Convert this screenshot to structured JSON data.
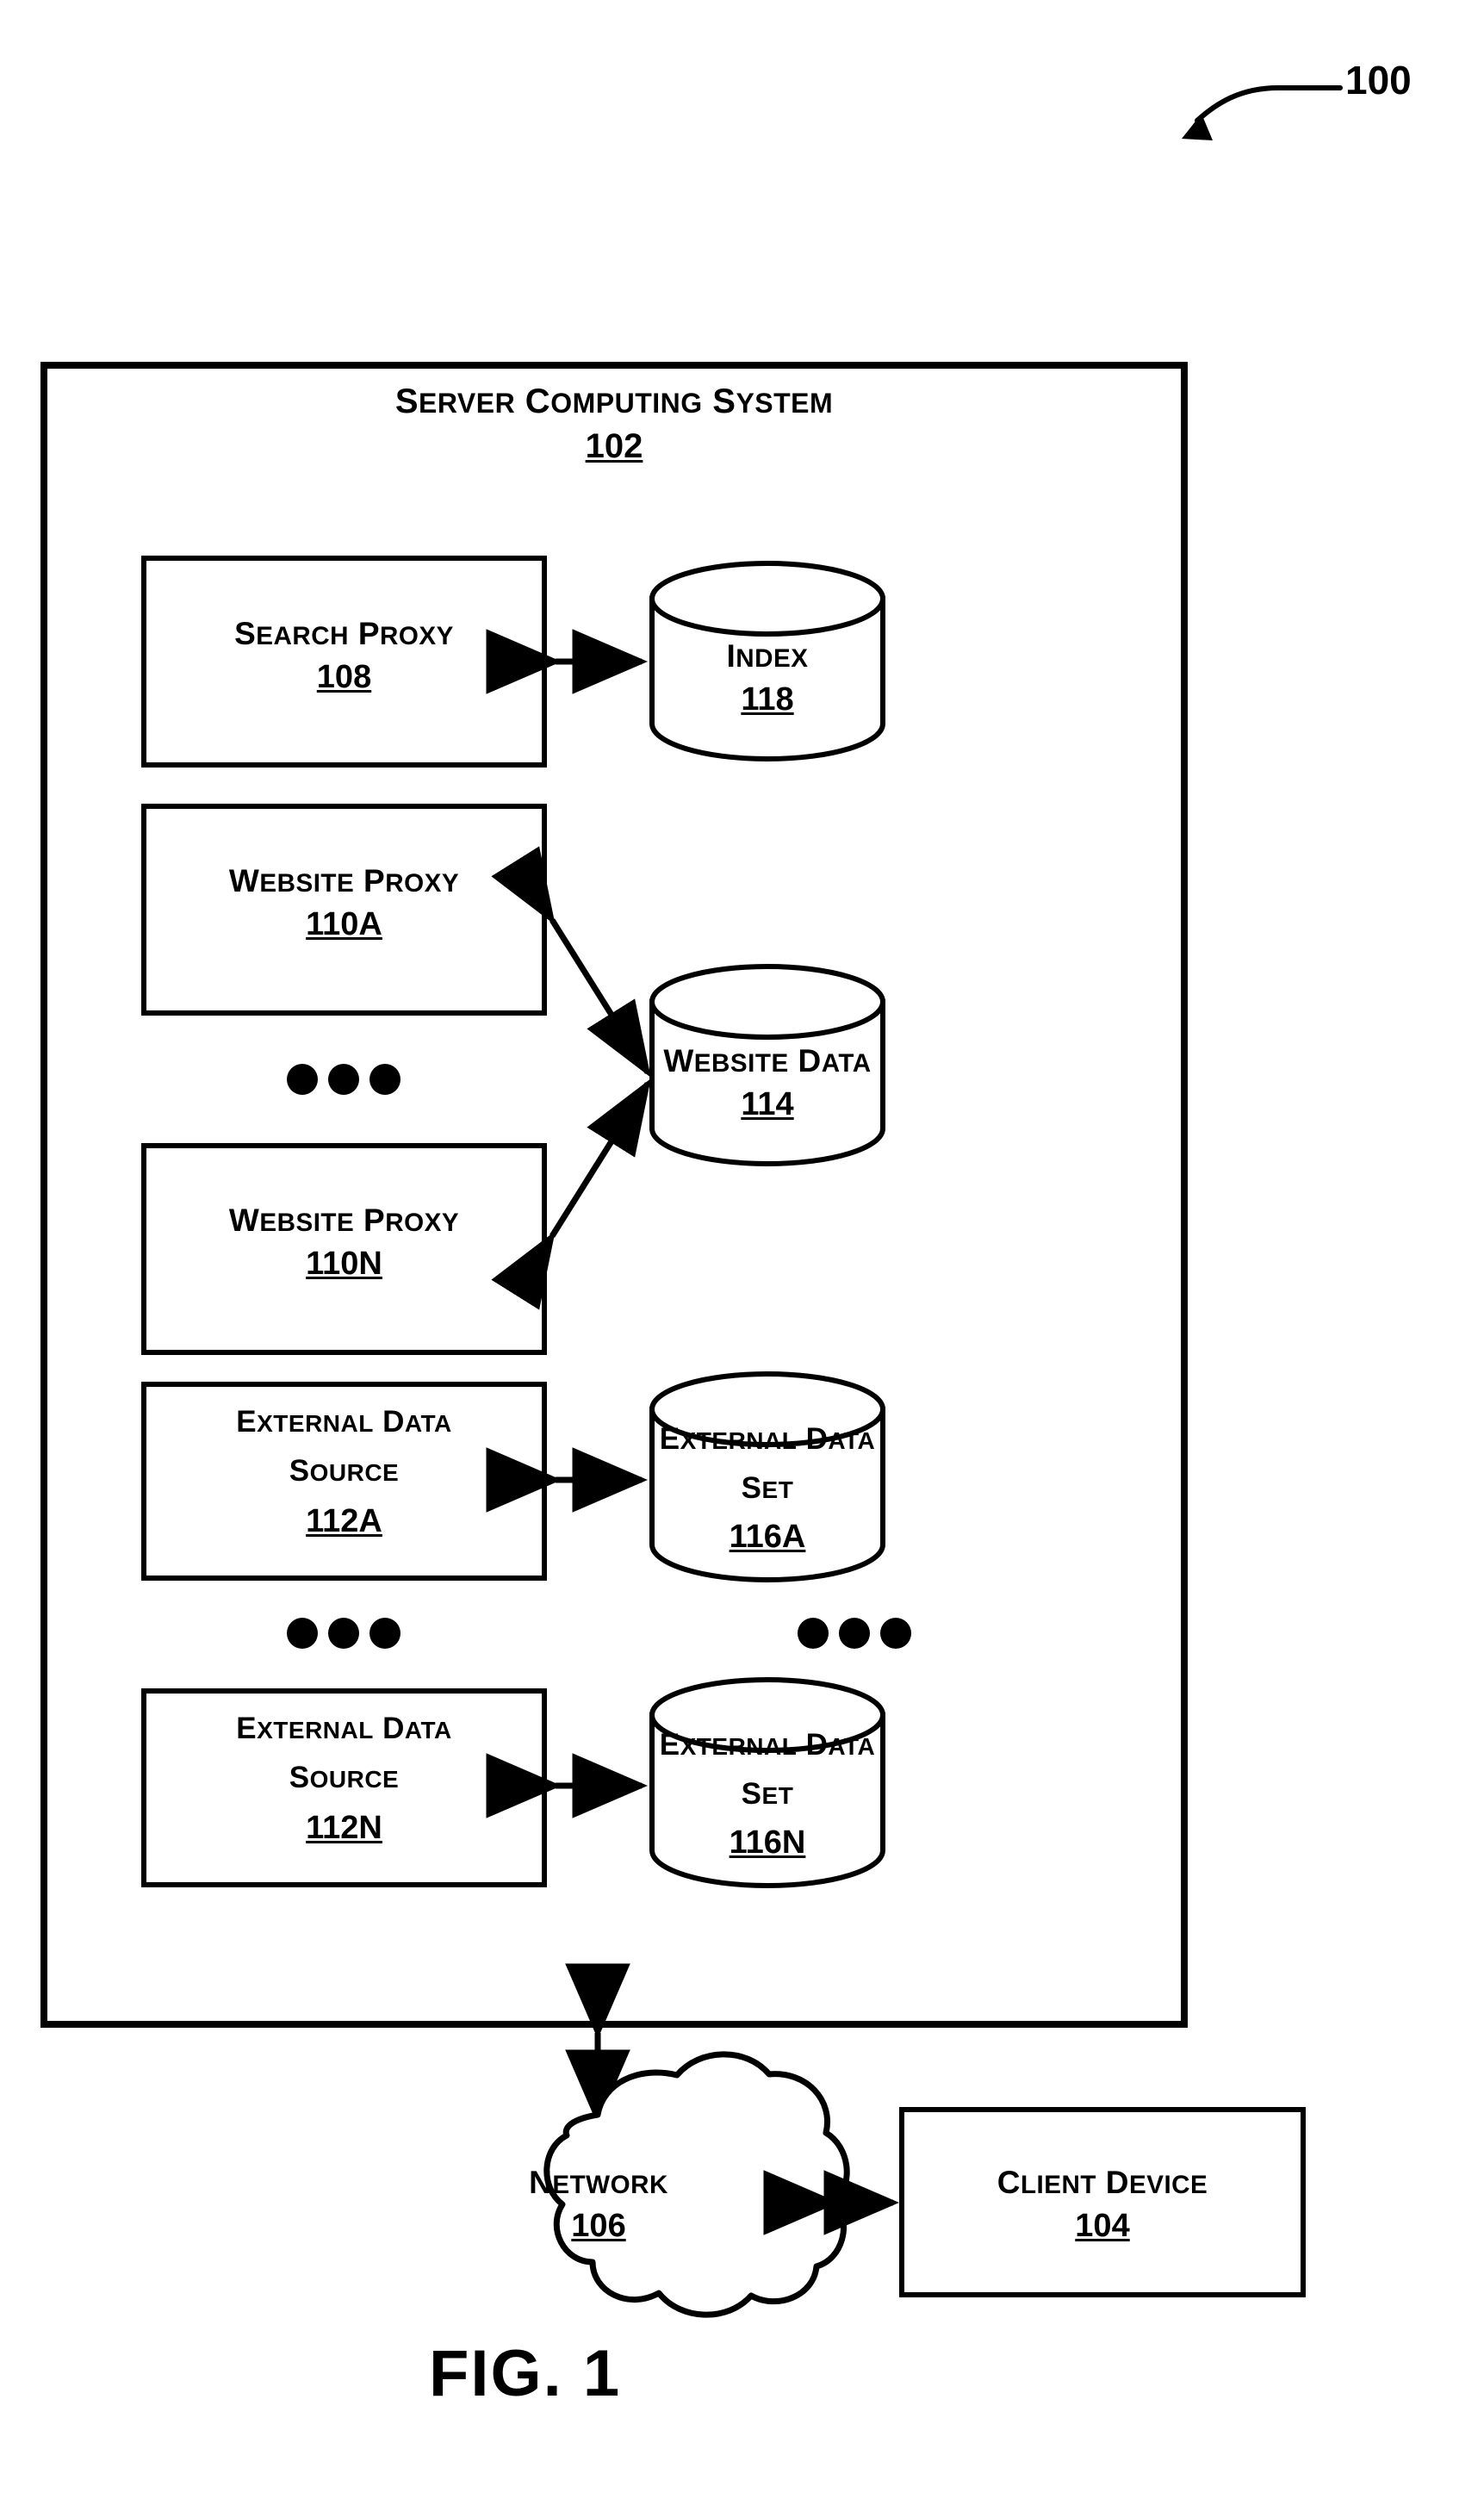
{
  "figure": {
    "caption": "FIG. 1",
    "reference_numeral": "100"
  },
  "system": {
    "title": "SERVER COMPUTING SYSTEM",
    "numeral": "102"
  },
  "nodes": {
    "search_proxy": {
      "label": "SEARCH PROXY",
      "numeral": "108",
      "shape": "box"
    },
    "index": {
      "label": "INDEX",
      "numeral": "118",
      "shape": "cylinder"
    },
    "website_proxy_a": {
      "label": "WEBSITE PROXY",
      "numeral": "110A",
      "shape": "box"
    },
    "website_proxy_n": {
      "label": "WEBSITE PROXY",
      "numeral": "110N",
      "shape": "box"
    },
    "website_data": {
      "label": "WEBSITE DATA",
      "numeral": "114",
      "shape": "cylinder"
    },
    "external_data_source_a": {
      "label_line1": "EXTERNAL DATA",
      "label_line2": "SOURCE",
      "numeral": "112A",
      "shape": "box"
    },
    "external_data_source_n": {
      "label_line1": "EXTERNAL DATA",
      "label_line2": "SOURCE",
      "numeral": "112N",
      "shape": "box"
    },
    "external_data_set_a": {
      "label_line1": "EXTERNAL DATA",
      "label_line2": "SET",
      "numeral": "116A",
      "shape": "cylinder"
    },
    "external_data_set_n": {
      "label_line1": "EXTERNAL DATA",
      "label_line2": "SET",
      "numeral": "116N",
      "shape": "cylinder"
    },
    "network": {
      "label": "NETWORK",
      "numeral": "106",
      "shape": "cloud"
    },
    "client_device": {
      "label": "CLIENT DEVICE",
      "numeral": "104",
      "shape": "box"
    }
  },
  "connections": [
    {
      "from": "search_proxy",
      "to": "index",
      "style": "double-arrow-horizontal"
    },
    {
      "from": "website_proxy_a",
      "to": "website_data",
      "style": "double-arrow-diagonal"
    },
    {
      "from": "website_proxy_n",
      "to": "website_data",
      "style": "double-arrow-diagonal"
    },
    {
      "from": "external_data_source_a",
      "to": "external_data_set_a",
      "style": "double-arrow-horizontal"
    },
    {
      "from": "external_data_source_n",
      "to": "external_data_set_n",
      "style": "double-arrow-horizontal"
    },
    {
      "from": "system",
      "to": "network",
      "style": "double-arrow-vertical"
    },
    {
      "from": "network",
      "to": "client_device",
      "style": "double-arrow-horizontal"
    }
  ],
  "ellipses": [
    {
      "id": "proxy-ellipsis",
      "dots": 3
    },
    {
      "id": "external-source-ellipsis",
      "dots": 3
    },
    {
      "id": "external-set-ellipsis",
      "dots": 3
    }
  ],
  "style": {
    "stroke": "#000000",
    "fill": "#ffffff",
    "background": "#ffffff"
  }
}
